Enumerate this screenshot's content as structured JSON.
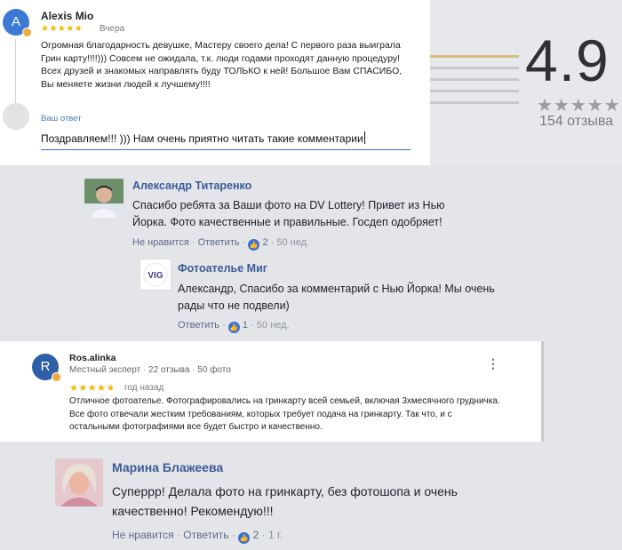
{
  "review1": {
    "avatar_letter": "A",
    "author": "Alexis Mio",
    "stars": "★★★★★",
    "date": "Вчера",
    "text": "Огромная благодарность девушке, Мастеру своего дела! С первого раза выиграла Грин карту!!!!))) Совсем не ожидала, т.к. люди годами проходят данную процедуру! Всех друзей и знакомых направлять буду ТОЛЬКО к ней! Большое Вам СПАСИБО, Вы меняете жизни людей к лучшему!!!!",
    "reply_label": "Ваш ответ",
    "reply_value": "Поздравляем!!! ))) Нам очень приятно читать такие комментарии"
  },
  "rating": {
    "value": "4.9",
    "stars": "★★★★★",
    "count": "154 отзыва"
  },
  "comments": [
    {
      "author": "Александр Титаренко",
      "text": "Спасибо ребята за Ваши фото на DV Lottery! Привет из Нью Йорка. Фото качественные и правильные. Госдеп одобряет!",
      "dislike": "Не нравится",
      "reply": "Ответить",
      "likes": "2",
      "time": "50 нед."
    },
    {
      "author": "Фотоателье Миг",
      "logo_text": "VIG",
      "text": "Александр, Спасибо за комментарий с Нью Йорка! Мы очень рады что не подвели)",
      "reply": "Ответить",
      "likes": "1",
      "time": "50 нед."
    }
  ],
  "review2": {
    "avatar_letter": "R",
    "author": "Ros.alinka",
    "badge": "Местный эксперт",
    "reviews": "22 отзыва",
    "photos": "50 фото",
    "stars": "★★★★★",
    "date": "год назад",
    "text": "Отличное фотоателье. Фотографировались на гринкарту всей семьей, включая 3хмесячного грудничка. Все фото отвечали жестким требованиям, которых требует подача на гринкарту. Так что, и с остальными фотографиями все будет быстро и качественно."
  },
  "comment3": {
    "author": "Марина Блажеева",
    "text": "Суперрр! Делала фото на гринкарту, без фотошопа и очень качественно! Рекомендую!!!",
    "dislike": "Не нравится",
    "reply": "Ответить",
    "likes": "2",
    "time": "1 г."
  }
}
